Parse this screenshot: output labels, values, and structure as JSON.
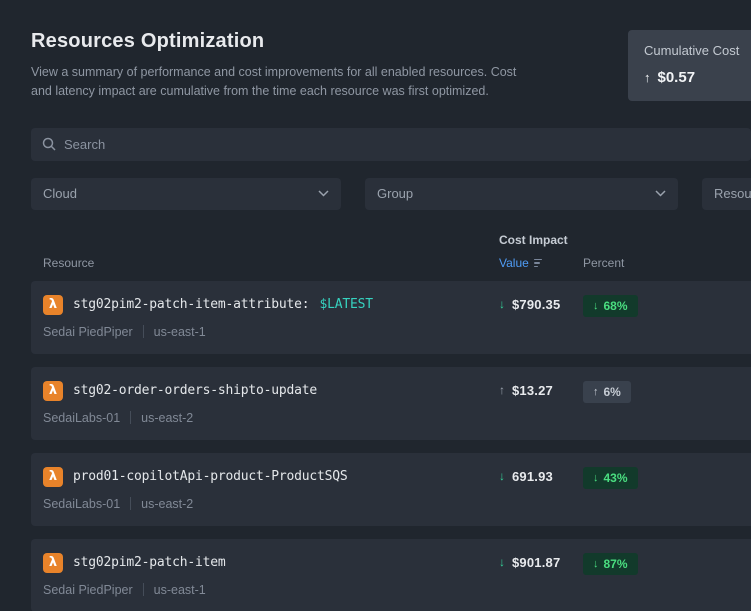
{
  "page": {
    "title": "Resources Optimization",
    "subtitle": "View a summary of performance and cost improvements for all enabled resources. Cost and latency impact are cumulative from the time each resource was first optimized."
  },
  "cumulative_cost": {
    "label": "Cumulative Cost",
    "arrow": "↑",
    "value": "$0.57"
  },
  "search": {
    "placeholder": "Search"
  },
  "filters": {
    "cloud": "Cloud",
    "group": "Group",
    "resource": "Resource"
  },
  "table": {
    "group_header": "Cost Impact",
    "col_resource": "Resource",
    "col_value": "Value",
    "col_percent": "Percent"
  },
  "rows": [
    {
      "name": "stg02pim2-patch-item-attribute:",
      "suffix": "$LATEST",
      "account": "Sedai PiedPiper",
      "region": "us-east-1",
      "dir": "down",
      "arrow": "↓",
      "value": "$790.35",
      "percent": "68%"
    },
    {
      "name": "stg02-order-orders-shipto-update",
      "suffix": "",
      "account": "SedaiLabs-01",
      "region": "us-east-2",
      "dir": "up",
      "arrow": "↑",
      "value": "$13.27",
      "percent": "6%"
    },
    {
      "name": "prod01-copilotApi-product-ProductSQS",
      "suffix": "",
      "account": "SedaiLabs-01",
      "region": "us-east-2",
      "dir": "down",
      "arrow": "↓",
      "value": "691.93",
      "percent": "43%"
    },
    {
      "name": "stg02pim2-patch-item",
      "suffix": "",
      "account": "Sedai PiedPiper",
      "region": "us-east-1",
      "dir": "down",
      "arrow": "↓",
      "value": "$901.87",
      "percent": "87%"
    }
  ],
  "colors": {
    "accent_blue": "#4f9cf6",
    "positive_green": "#34d399",
    "lambda_orange": "#e8832a",
    "latest_teal": "#36d3c0"
  }
}
